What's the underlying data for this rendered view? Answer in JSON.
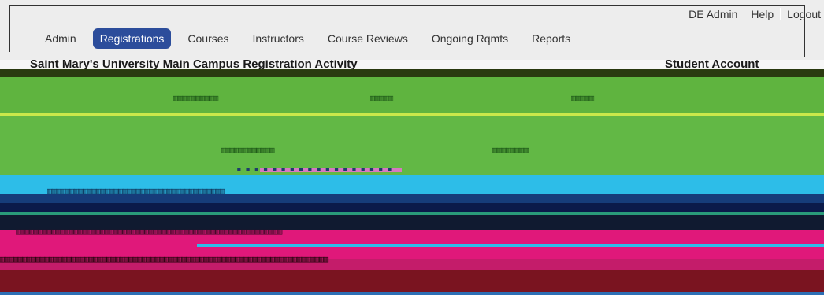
{
  "header": {
    "util_links": [
      "DE Admin",
      "Help",
      "Logout"
    ]
  },
  "nav": {
    "items": [
      {
        "label": "Admin",
        "active": false
      },
      {
        "label": "Registrations",
        "active": true
      },
      {
        "label": "Courses",
        "active": false
      },
      {
        "label": "Instructors",
        "active": false
      },
      {
        "label": "Course Reviews",
        "active": false
      },
      {
        "label": "Ongoing Rqmts",
        "active": false
      },
      {
        "label": "Reports",
        "active": false
      }
    ]
  },
  "page": {
    "title_fragment": "Saint Mary's University Main Campus Registration Activity",
    "right_fragment": "Student Account"
  },
  "colors": {
    "active_tab": "#2c4d9b",
    "glitch_green": "#5fb43f",
    "glitch_cyan": "#2dbde8",
    "glitch_magenta": "#e0187a",
    "glitch_maroon": "#7a1420",
    "glitch_navy": "#0b1a4a"
  }
}
